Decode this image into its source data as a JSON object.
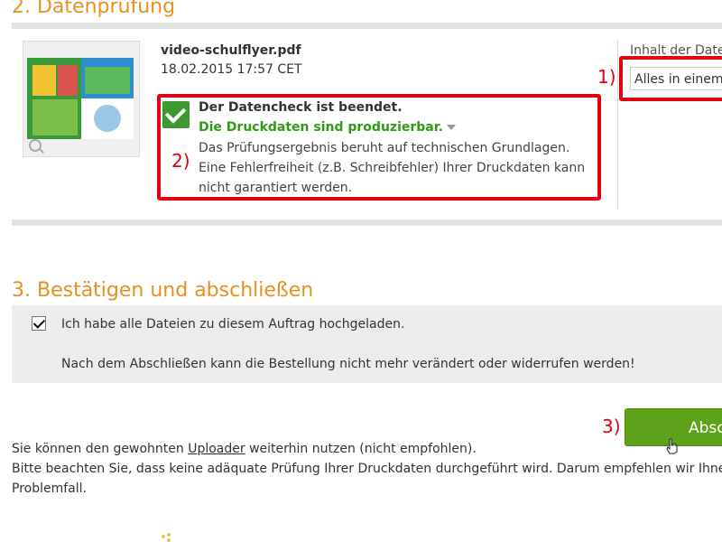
{
  "sections": {
    "datenpruefung_title": "2. Datenprüfung",
    "bestaetigen_title": "3. Bestätigen und abschließen"
  },
  "file": {
    "name": "video-schulflyer.pdf",
    "date": "18.02.2015 17:57 CET"
  },
  "check": {
    "title": "Der Datencheck ist beendet.",
    "status": "Die Druckdaten sind produzierbar.",
    "description": "Das Prüfungsergebnis beruht auf technischen Grundlagen. Eine Fehlerfreiheit (z.B. Schreibfehler) Ihrer Druckdaten kann nicht garantiert werden."
  },
  "content": {
    "label": "Inhalt der Date",
    "select_value": "Alles in einem"
  },
  "annotations": {
    "one": "1)",
    "two": "2)",
    "three": "3)"
  },
  "confirm": {
    "checkbox_label": "Ich habe alle Dateien zu diesem Auftrag hochgeladen.",
    "checked": true,
    "note": "Nach dem Abschließen kann die Bestellung nicht mehr verändert oder widerrufen werden!"
  },
  "button": {
    "label": "Absc"
  },
  "footer": {
    "line1_pre": "Sie können den gewohnten ",
    "line1_link": "Uploader",
    "line1_post": " weiterhin nutzen (nicht empfohlen).",
    "line2": "Bitte beachten Sie, dass keine adäquate Prüfung Ihrer Druckdaten durchgeführt wird. Darum empfehlen wir Ihnen",
    "line3": "Problemfall."
  },
  "colors": {
    "accent_orange": "#e8901f",
    "success_green": "#2f9a16",
    "button_green": "#5ea11a",
    "annotation_red": "#e0000f"
  }
}
